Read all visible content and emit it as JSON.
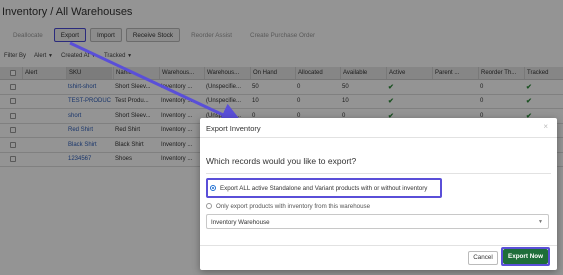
{
  "header": {
    "title": "Inventory / All Warehouses"
  },
  "toolbar": {
    "deallocate": "Deallocate",
    "export": "Export",
    "import": "Import",
    "receive_stock": "Receive Stock",
    "reorder_assist": "Reorder Assist",
    "create_po": "Create Purchase Order"
  },
  "filters": {
    "label": "Filter By",
    "alert": "Alert",
    "created_at": "Created At",
    "tracked": "Tracked"
  },
  "table": {
    "columns": [
      "Alert",
      "SKU",
      "Name",
      "Warehous...",
      "Warehous...",
      "On Hand",
      "Allocated",
      "Available",
      "Active",
      "Parent ...",
      "Reorder Th...",
      "Tracked"
    ],
    "rows": [
      {
        "sku": "tshirt-short",
        "name": "Short Sleev...",
        "wh": "Inventory ...",
        "wh2": "(Unspecifie...",
        "on_hand": "50",
        "allocated": "0",
        "available": "50",
        "reorder": "0"
      },
      {
        "sku": "TEST-PRODUC",
        "name": "Test Produ...",
        "wh": "Inventory ...",
        "wh2": "(Unspecifie...",
        "on_hand": "10",
        "allocated": "0",
        "available": "10",
        "reorder": "0"
      },
      {
        "sku": "short",
        "name": "Short Sleev...",
        "wh": "Inventory ...",
        "wh2": "(Unspecifie...",
        "on_hand": "0",
        "allocated": "0",
        "available": "0",
        "reorder": "0"
      },
      {
        "sku": "Red Shirt",
        "name": "Red Shirt",
        "wh": "Inventory ...",
        "wh2": "",
        "on_hand": "",
        "allocated": "",
        "available": "",
        "reorder": ""
      },
      {
        "sku": "Black Shirt",
        "name": "Black Shirt",
        "wh": "Inventory ...",
        "wh2": "",
        "on_hand": "",
        "allocated": "",
        "available": "",
        "reorder": ""
      },
      {
        "sku": "1234567",
        "name": "Shoes",
        "wh": "Inventory ...",
        "wh2": "",
        "on_hand": "",
        "allocated": "",
        "available": "",
        "reorder": ""
      }
    ],
    "check_glyph": "✔"
  },
  "modal": {
    "title": "Export Inventory",
    "close": "×",
    "question": "Which records would you like to export?",
    "option_all": "Export ALL active Standalone and Variant products with or without inventory",
    "option_warehouse": "Only export products with inventory from this warehouse",
    "select_value": "Inventory Warehouse",
    "select_caret": "▼",
    "cancel": "Cancel",
    "export_now": "Export Now"
  },
  "colors": {
    "highlight": "#5a4fd8",
    "export_button": "#1e6e3a",
    "link": "#2b5cb8",
    "check": "#2e8b3a"
  }
}
